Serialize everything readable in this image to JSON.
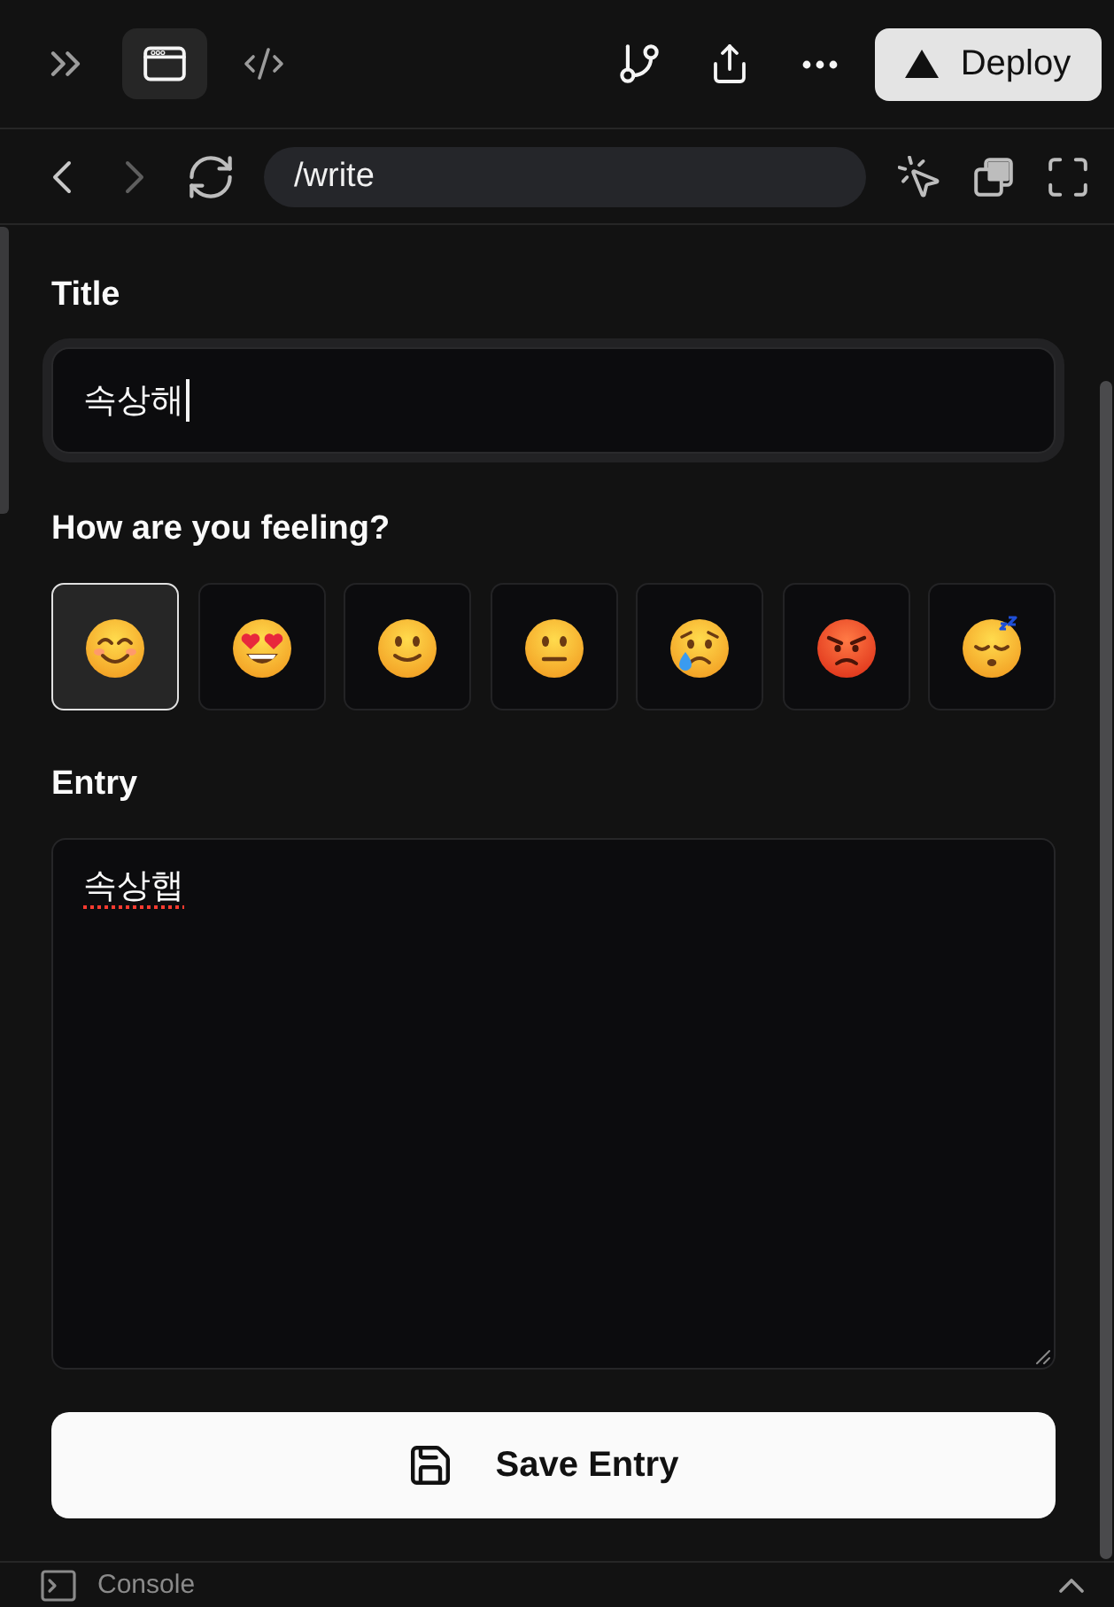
{
  "toolbar": {
    "views": [
      {
        "kind": "preview",
        "selected": true
      },
      {
        "kind": "code",
        "selected": false
      }
    ],
    "deploy_button": "Deploy"
  },
  "address_bar": {
    "back": {
      "disabled": false
    },
    "forward": {
      "disabled": true
    },
    "url": "/write"
  },
  "form": {
    "title_label": "Title",
    "title_field": {
      "value": "속상해",
      "focused": true
    },
    "mood_label": "How are you feeling?",
    "moods": [
      {
        "kind": "smiling",
        "selected": true
      },
      {
        "kind": "heart-eyes",
        "selected": false
      },
      {
        "kind": "slight-smile",
        "selected": false
      },
      {
        "kind": "neutral",
        "selected": false
      },
      {
        "kind": "crying",
        "selected": false
      },
      {
        "kind": "angry",
        "selected": false
      },
      {
        "kind": "sleeping",
        "selected": false
      }
    ],
    "entry_label": "Entry",
    "entry_field": {
      "value": "속상햅",
      "misspelled": true
    },
    "save_button": "Save Entry"
  },
  "console": {
    "label": "Console"
  }
}
